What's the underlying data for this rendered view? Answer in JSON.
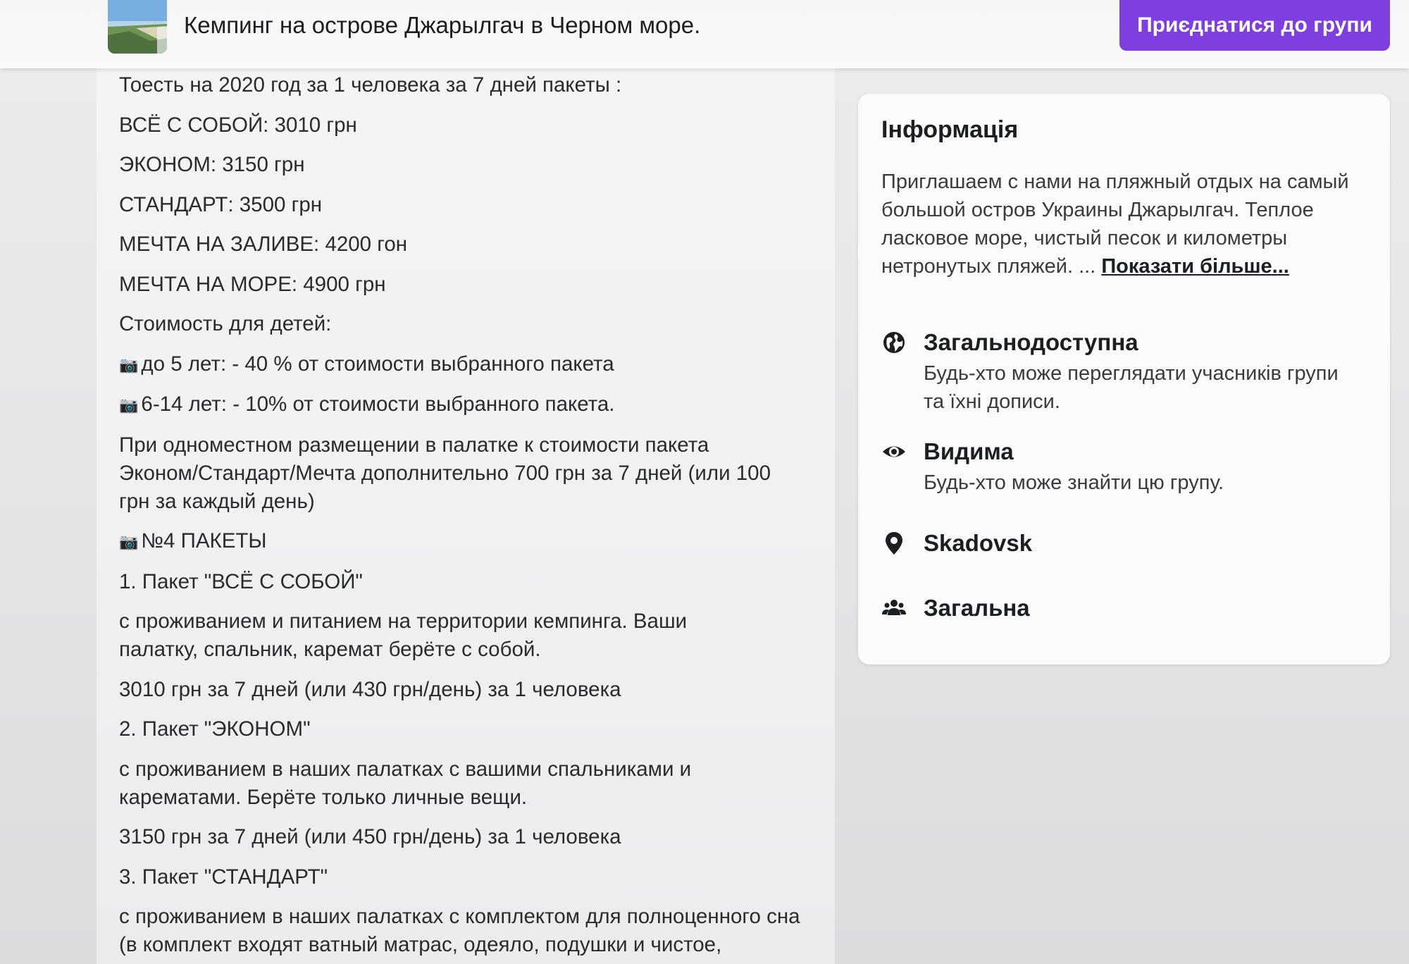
{
  "header": {
    "group_title": "Кемпинг на острове Джарылгач в Черном море.",
    "join_button": "Приєднатися до групи"
  },
  "post": {
    "paragraphs": [
      {
        "text": "Тоесть на 2020 год за 1 человека за 7 дней пакеты :"
      },
      {
        "text": "ВСЁ С СОБОЙ: 3010 грн"
      },
      {
        "text": "ЭКОНОМ: 3150 грн"
      },
      {
        "text": "СТАНДАРТ: 3500 грн"
      },
      {
        "text": "МЕЧТА НА ЗАЛИВЕ: 4200 гон"
      },
      {
        "text": "МЕЧТА НА МОРЕ: 4900 грн"
      },
      {
        "text": "Стоимость для детей:"
      },
      {
        "text": "до 5 лет: - 40 % от стоимости выбранного пакета",
        "icon": "camera-icon"
      },
      {
        "text": "6-14 лет: - 10% от стоимости выбранного пакета.",
        "icon": "camera-icon"
      },
      {
        "text": "При одноместном размещении в палатке к стоимости пакета Эконом/Стандарт/Мечта дополнительно 700 грн за 7 дней (или 100 грн за каждый день)"
      },
      {
        "text": "№4 ПАКЕТЫ",
        "icon": "camera-icon"
      },
      {
        "text": "1. Пакет \"ВСЁ С СОБОЙ\""
      },
      {
        "text": "с проживанием и питанием на территории кемпинга. Ваши палатку, спальник, каремат берёте с собой."
      },
      {
        "text": "3010 грн за 7 дней (или 430 грн/день) за 1 человека"
      },
      {
        "text": "2. Пакет \"ЭКОНОМ\""
      },
      {
        "text": "с проживанием в наших палатках с вашими спальниками и карематами. Берёте только личные вещи."
      },
      {
        "text": "3150 грн за 7 дней (или 450 грн/день) за 1 человека"
      },
      {
        "text": "3. Пакет \"СТАНДАРТ\""
      },
      {
        "text": "с проживанием в наших палатках с комплектом для полноценного сна (в комплект входят ватный матрас, одеяло, подушки и чистое,"
      }
    ]
  },
  "info": {
    "heading": "Інформація",
    "description": "Приглашаем с нами на пляжный отдых на самый большой остров Украины Джарылгач. Теплое ласковое море, чистый песок и километры нетронутых пляжей. ... ",
    "show_more": "Показати більше...",
    "rows": {
      "public": {
        "icon": "globe-icon",
        "title": "Загальнодоступна",
        "subtitle": "Будь-хто може переглядати учасників групи та їхні дописи."
      },
      "visible": {
        "icon": "eye-icon",
        "title": "Видима",
        "subtitle": "Будь-хто може знайти цю групу."
      },
      "location": {
        "icon": "location-pin-icon",
        "title": "Skadovsk"
      },
      "type": {
        "icon": "people-icon",
        "title": "Загальна"
      }
    }
  },
  "colors": {
    "accent": "#7e3ee0",
    "text": "#1c1e21",
    "secondary_text": "#3a3b3d"
  }
}
